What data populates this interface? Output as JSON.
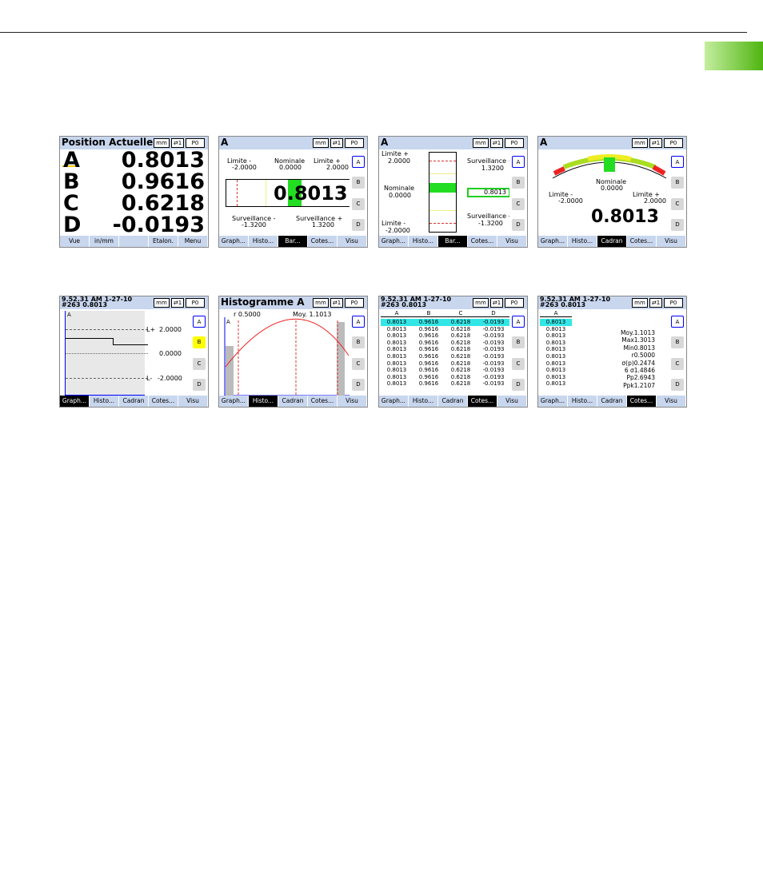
{
  "units": {
    "mm": "mm",
    "icon": "⇄1",
    "p": "P0"
  },
  "side_buttons": [
    "A",
    "B",
    "C",
    "D"
  ],
  "s1": {
    "title": "Position Actuelle",
    "rows": [
      {
        "l": "A",
        "v": "0.8013"
      },
      {
        "l": "B",
        "v": "0.9616"
      },
      {
        "l": "C",
        "v": "0.6218"
      },
      {
        "l": "D",
        "v": "-0.0193"
      }
    ],
    "menu": [
      "Vue",
      "in/mm",
      "",
      "Etalon.",
      "Menu"
    ]
  },
  "soft": [
    "Graph...",
    "Histo...",
    "Bar...",
    "Cotes...",
    "Visu"
  ],
  "soft2": [
    "Graph...",
    "Histo...",
    "Cadran",
    "Cotes...",
    "Visu"
  ],
  "s2": {
    "title": "A",
    "lim_minus": "Limite  -",
    "lim_minus_v": "-2.0000",
    "nom": "Nominale",
    "nom_v": "0.0000",
    "lim_plus": "Limite  +",
    "lim_plus_v": "2.0000",
    "value": "0.8013",
    "surv_minus": "Surveillance  -",
    "surv_minus_v": "-1.3200",
    "surv_plus": "Surveillance  +",
    "surv_plus_v": "1.3200"
  },
  "s3": {
    "title": "A",
    "lim_plus": "Limite  +",
    "lim_plus_v": "2.0000",
    "nom": "Nominale",
    "nom_v": "0.0000",
    "lim_minus": "Limite  -",
    "lim_minus_v": "-2.0000",
    "surv_plus": "Surveillance  +",
    "surv_plus_v": "1.3200",
    "value": "0.8013",
    "surv_minus": "Surveillance  -",
    "surv_minus_v": "-1.3200"
  },
  "s4": {
    "title": "A",
    "nom": "Nominale",
    "nom_v": "0.0000",
    "lim_minus": "Limite  -",
    "lim_minus_v": "-2.0000",
    "lim_plus": "Limite  +",
    "lim_plus_v": "2.0000",
    "value": "0.8013"
  },
  "hdr": {
    "line1": "9.52.31  AM  1-27-10",
    "line2": "#263      0.8013"
  },
  "s5": {
    "ch": "A",
    "lp": "L+",
    "lpv": "2.0000",
    "mid": "0.0000",
    "lm": "L-",
    "lmv": "-2.0000"
  },
  "s6": {
    "title": "Histogramme  A",
    "r": "r  0.5000",
    "moy": "Moy.  1.1013",
    "ch": "A"
  },
  "s7": {
    "cols": [
      "A",
      "B",
      "C",
      "D"
    ],
    "rows": [
      [
        "0.8013",
        "0.9616",
        "0.6218",
        "-0.0193"
      ],
      [
        "0.8013",
        "0.9616",
        "0.6218",
        "-0.0193"
      ],
      [
        "0.8013",
        "0.9616",
        "0.6218",
        "-0.0193"
      ],
      [
        "0.8013",
        "0.9616",
        "0.6218",
        "-0.0193"
      ],
      [
        "0.8013",
        "0.9616",
        "0.6218",
        "-0.0193"
      ],
      [
        "0.8013",
        "0.9616",
        "0.6218",
        "-0.0193"
      ],
      [
        "0.8013",
        "0.9616",
        "0.6218",
        "-0.0193"
      ],
      [
        "0.8013",
        "0.9616",
        "0.6218",
        "-0.0193"
      ],
      [
        "0.8013",
        "0.9616",
        "0.6218",
        "-0.0193"
      ],
      [
        "0.8013",
        "0.9616",
        "0.6218",
        "-0.0193"
      ]
    ]
  },
  "s8": {
    "col": "A",
    "values": [
      "0.8013",
      "0.8013",
      "0.8013",
      "0.8013",
      "0.8013",
      "0.8013",
      "0.8013",
      "0.8013",
      "0.8013",
      "0.8013"
    ],
    "stats": [
      "Moy.1.1013",
      "Max1.3013",
      "Min0.8013",
      "r0.5000",
      "σ(p)0.2474",
      "6  σ1.4846",
      "Pp2.6943",
      "Ppk1.2107"
    ]
  }
}
